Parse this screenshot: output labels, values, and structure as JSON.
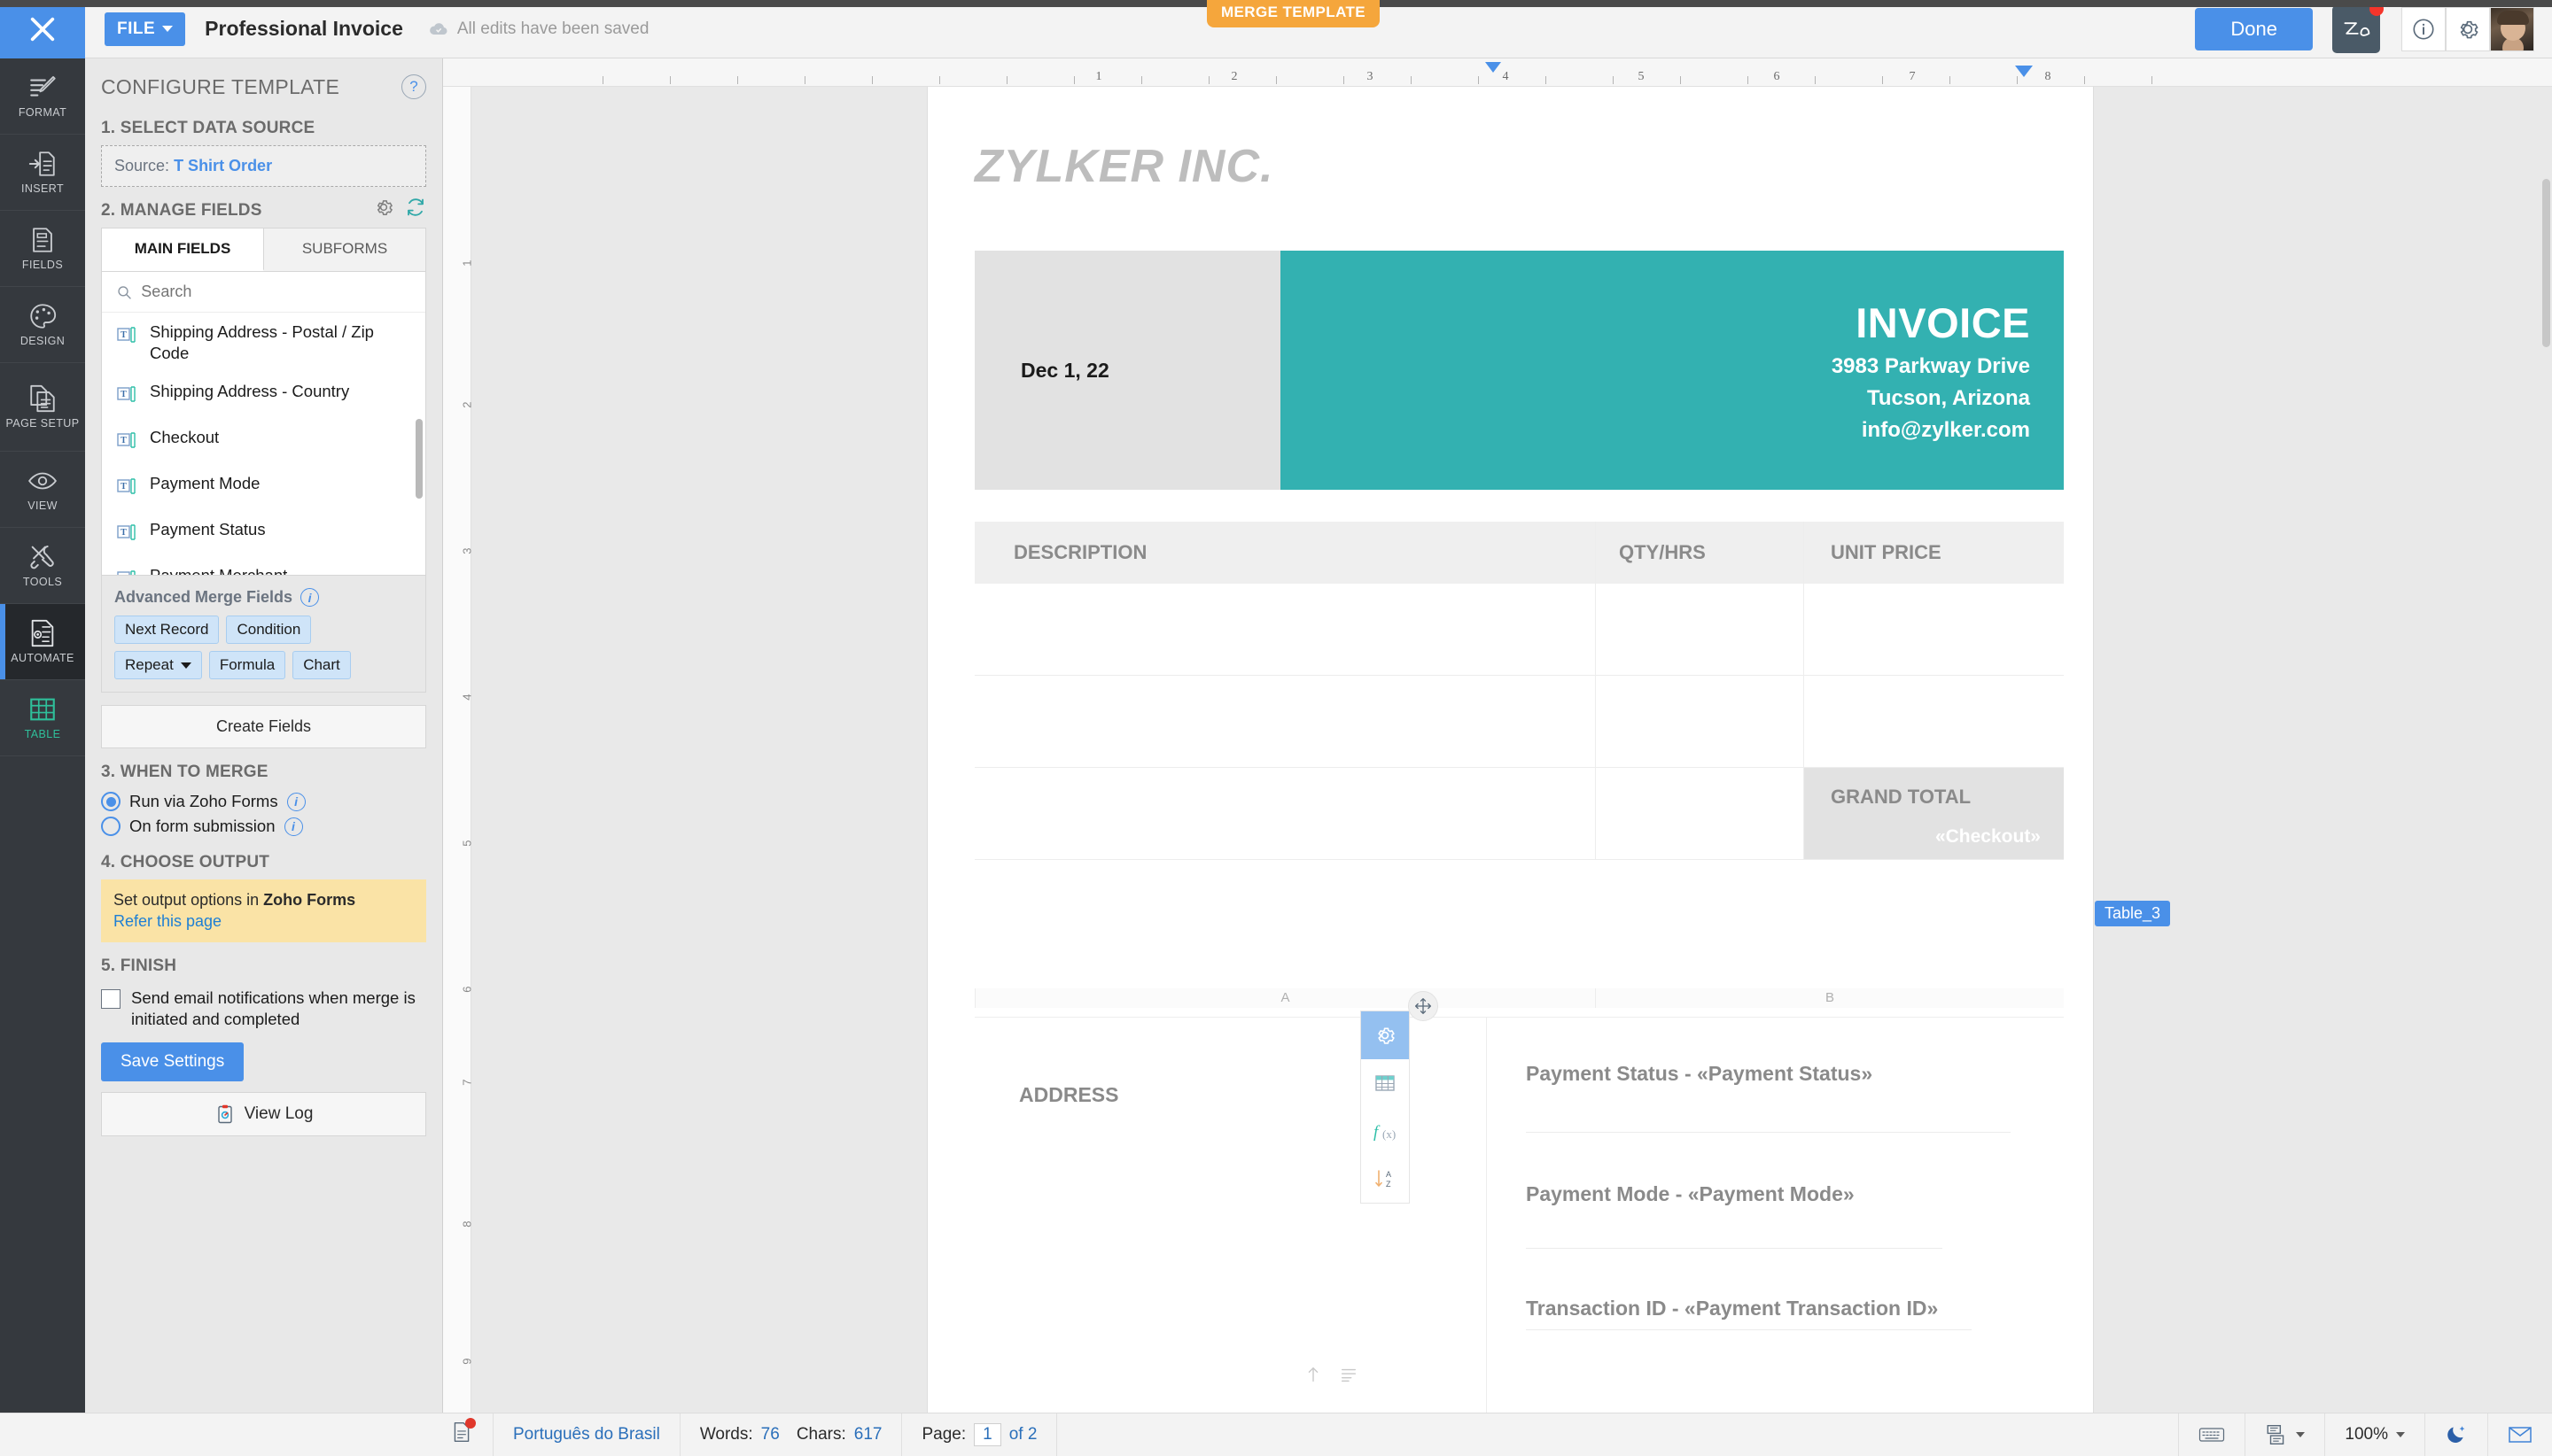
{
  "topbar": {
    "close_icon": "close-icon",
    "file_label": "FILE",
    "doc_title": "Professional Invoice",
    "save_status": "All edits have been saved",
    "merge_badge": "MERGE TEMPLATE",
    "done_label": "Done",
    "zia_label": "Zia",
    "info_icon": "info-icon",
    "settings_icon": "gear-icon",
    "avatar": "user-avatar"
  },
  "rail": {
    "items": [
      {
        "label": "FORMAT",
        "icon": "format-pencil-icon",
        "active": false
      },
      {
        "label": "INSERT",
        "icon": "insert-document-icon",
        "active": false
      },
      {
        "label": "FIELDS",
        "icon": "fields-card-icon",
        "active": false
      },
      {
        "label": "DESIGN",
        "icon": "design-palette-icon",
        "active": false
      },
      {
        "label": "PAGE SETUP",
        "icon": "page-setup-icon",
        "active": false
      },
      {
        "label": "VIEW",
        "icon": "view-eye-icon",
        "active": false
      },
      {
        "label": "TOOLS",
        "icon": "tools-wrench-icon",
        "active": false
      },
      {
        "label": "AUTOMATE",
        "icon": "automate-gear-doc-icon",
        "active": true
      },
      {
        "label": "TABLE",
        "icon": "table-grid-icon",
        "active": false
      }
    ]
  },
  "panel": {
    "title": "CONFIGURE TEMPLATE",
    "help_icon": "question-mark-icon",
    "step1": {
      "heading": "1. SELECT DATA SOURCE",
      "source_label": "Source:",
      "source_value": "T Shirt Order"
    },
    "step2": {
      "heading": "2. MANAGE FIELDS",
      "gear_icon": "gear-icon",
      "refresh_icon": "refresh-icon",
      "tabs": [
        {
          "label": "MAIN FIELDS",
          "active": true
        },
        {
          "label": "SUBFORMS",
          "active": false
        }
      ],
      "search_placeholder": "Search",
      "search_value": "",
      "search_icon": "search-icon",
      "fields": [
        "Shipping Address - Postal / Zip Code",
        "Shipping Address - Country",
        "Checkout",
        "Payment Mode",
        "Payment Status",
        "Payment Merchant"
      ],
      "advanced_title": "Advanced Merge Fields",
      "advanced_info_icon": "info-icon",
      "advanced_chips": [
        {
          "label": "Next Record",
          "dropdown": false
        },
        {
          "label": "Condition",
          "dropdown": false
        },
        {
          "label": "Repeat",
          "dropdown": true
        },
        {
          "label": "Formula",
          "dropdown": false
        },
        {
          "label": "Chart",
          "dropdown": false
        }
      ],
      "create_fields_label": "Create Fields"
    },
    "step3": {
      "heading": "3. WHEN TO MERGE",
      "options": [
        {
          "label": "Run via Zoho Forms",
          "selected": true
        },
        {
          "label": "On form submission",
          "selected": false
        }
      ]
    },
    "step4": {
      "heading": "4. CHOOSE OUTPUT",
      "note_prefix": "Set output options in ",
      "note_bold": "Zoho Forms",
      "note_link": "Refer this page"
    },
    "step5": {
      "heading": "5. FINISH",
      "checkbox_label": "Send email notifications when merge is initiated and completed",
      "checkbox_checked": false,
      "save_label": "Save Settings",
      "view_log_label": "View Log",
      "view_log_icon": "clipboard-icon"
    }
  },
  "ruler": {
    "h_numbers": [
      "1",
      "2",
      "3",
      "4",
      "5",
      "6",
      "7",
      "8"
    ],
    "v_numbers": [
      "1",
      "2",
      "3",
      "4",
      "5",
      "6",
      "7",
      "8",
      "9"
    ]
  },
  "document": {
    "company": "ZYLKER INC.",
    "date": "Dec 1, 22",
    "invoice_title": "INVOICE",
    "address_line1": "3983 Parkway Drive",
    "address_line2": "Tucson, Arizona",
    "email": "info@zylker.com",
    "table": {
      "headers": [
        "DESCRIPTION",
        "QTY/HRS",
        "UNIT PRICE"
      ],
      "rows": [
        [
          "",
          "",
          ""
        ],
        [
          "",
          "",
          ""
        ],
        [
          "",
          "",
          ""
        ]
      ],
      "grand_total_label": "GRAND TOTAL",
      "grand_total_value": "«Checkout»",
      "column_markers": [
        "A",
        "B"
      ]
    },
    "address_label": "ADDRESS",
    "payment_lines": [
      "Payment Status - «Payment Status»",
      "Payment Mode - «Payment Mode»",
      "Transaction ID - «Payment Transaction ID»"
    ],
    "table_tag": "Table_3",
    "table_tools": [
      {
        "icon": "gear-icon",
        "active": true
      },
      {
        "icon": "table-properties-icon",
        "active": false
      },
      {
        "icon": "formula-fx-icon",
        "active": false
      },
      {
        "icon": "sort-az-icon",
        "active": false
      }
    ],
    "move_handle_icon": "move-handle-icon"
  },
  "statusbar": {
    "doc_icon": "document-issue-icon",
    "language": "Português do Brasil",
    "words_label": "Words:",
    "words_value": "76",
    "chars_label": "Chars:",
    "chars_value": "617",
    "page_label": "Page:",
    "page_current": "1",
    "page_of": "of 2",
    "keyboard_icon": "keyboard-icon",
    "layout_icon": "page-layout-icon",
    "zoom_value": "100%",
    "dark_mode_icon": "moon-icon",
    "mail_icon": "envelope-icon"
  }
}
